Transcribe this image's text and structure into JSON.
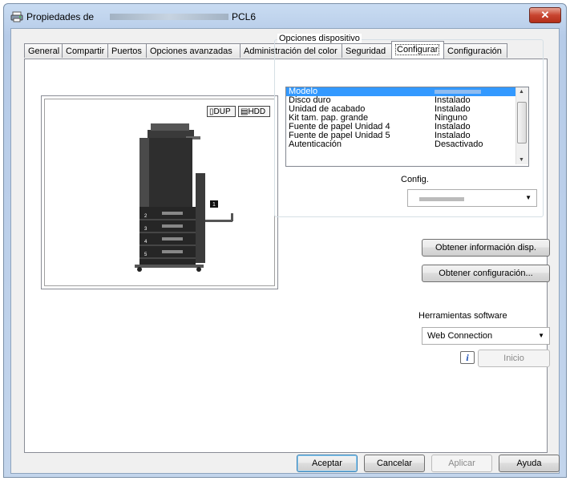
{
  "window": {
    "title_prefix": "Propiedades de",
    "title_suffix": "PCL6",
    "close_glyph": "✕"
  },
  "tabs": [
    {
      "label": "General"
    },
    {
      "label": "Compartir"
    },
    {
      "label": "Puertos"
    },
    {
      "label": "Opciones avanzadas"
    },
    {
      "label": "Administración del color"
    },
    {
      "label": "Seguridad"
    },
    {
      "label": "Configurar",
      "active": true
    },
    {
      "label": "Configuración"
    }
  ],
  "preview": {
    "dup_label": "DUP",
    "hdd_label": "HDD",
    "tray_numbers": [
      "2",
      "3",
      "4",
      "5"
    ],
    "callout": "1"
  },
  "device_options": {
    "group_label": "Opciones dispositivo",
    "rows": [
      {
        "label": "Modelo",
        "value": ""
      },
      {
        "label": "Disco duro",
        "value": "Instalado"
      },
      {
        "label": "Unidad de acabado",
        "value": "Instalado"
      },
      {
        "label": "Kit tam. pap. grande",
        "value": "Ninguno"
      },
      {
        "label": "Fuente de papel Unidad 4",
        "value": "Instalado"
      },
      {
        "label": "Fuente de papel Unidad 5",
        "value": "Instalado"
      },
      {
        "label": "Autenticación",
        "value": "Desactivado"
      }
    ],
    "config_label": "Config.",
    "config_value": ""
  },
  "buttons": {
    "obtain_info": "Obtener información disp.",
    "obtain_config": "Obtener configuración...",
    "start": "Inicio",
    "accept": "Aceptar",
    "cancel": "Cancelar",
    "apply": "Aplicar",
    "help": "Ayuda"
  },
  "software_tools": {
    "label": "Herramientas software",
    "selected": "Web Connection",
    "info_glyph": "i"
  },
  "colors": {
    "selection": "#3399ff",
    "close_button": "#c8442f",
    "title_bar": "#c9dcf2"
  }
}
